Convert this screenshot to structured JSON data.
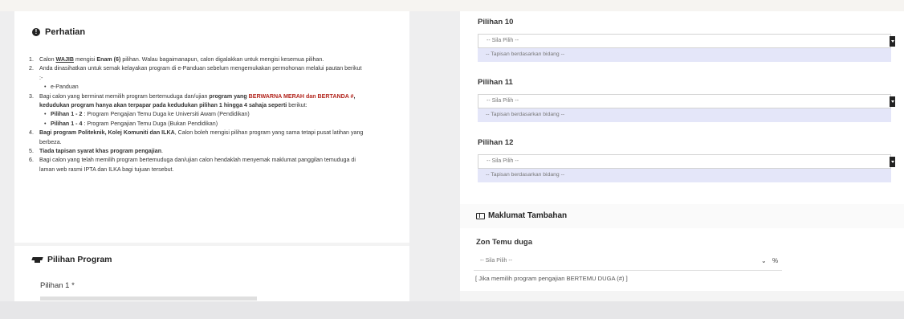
{
  "left": {
    "perhatian_title": "Perhatian",
    "notes": [
      {
        "num": "1.",
        "parts": [
          {
            "t": "Calon ",
            "s": ""
          },
          {
            "t": "WAJIB",
            "s": "u"
          },
          {
            "t": " mengisi ",
            "s": ""
          },
          {
            "t": "Enam (6)",
            "s": "b"
          },
          {
            "t": " pilihan. Walau bagaimanapun, calon digalakkan untuk mengisi kesemua pilihan.",
            "s": ""
          }
        ],
        "subs": []
      },
      {
        "num": "2.",
        "parts": [
          {
            "t": "Anda dinasihatkan untuk semak kelayakan program di e-Panduan sebelum mengemukakan permohonan melalui pautan berikut :-",
            "s": ""
          }
        ],
        "subs": [
          [
            {
              "t": "e-Panduan",
              "s": ""
            }
          ]
        ]
      },
      {
        "num": "3.",
        "parts": [
          {
            "t": "Bagi calon yang berminat memilih program bertemuduga dan/ujian ",
            "s": ""
          },
          {
            "t": "program yang ",
            "s": "b"
          },
          {
            "t": "BERWARNA MERAH dan BERTANDA #",
            "s": "red"
          },
          {
            "t": ", kedudukan program hanya akan terpapar pada kedudukan pilihan 1 hingga 4 sahaja seperti",
            "s": "b"
          },
          {
            "t": " berikut:",
            "s": ""
          }
        ],
        "subs": [
          [
            {
              "t": "Pilihan 1 - 2",
              "s": "b"
            },
            {
              "t": " : Program Pengajian Temu Duga ke Universiti Awam (Pendidikan)",
              "s": ""
            }
          ],
          [
            {
              "t": "Pilihan 1 - 4",
              "s": "b"
            },
            {
              "t": " : Program Pengajian Temu Duga (Bukan Pendidikan)",
              "s": ""
            }
          ]
        ]
      },
      {
        "num": "4.",
        "parts": [
          {
            "t": "Bagi program Politeknik, Kolej Komuniti dan ILKA",
            "s": "b"
          },
          {
            "t": ", Calon boleh mengisi pilihan program yang sama tetapi pusat latihan yang berbeza.",
            "s": ""
          }
        ],
        "subs": []
      },
      {
        "num": "5.",
        "parts": [
          {
            "t": "Tiada tapisan syarat khas program pengajian",
            "s": "b"
          },
          {
            "t": ".",
            "s": ""
          }
        ],
        "subs": []
      },
      {
        "num": "6.",
        "parts": [
          {
            "t": "Bagi calon yang telah memilih program bertemuduga dan/ujian calon hendaklah menyemak maklumat panggilan temuduga di laman web rasmi IPTA dan ILKA bagi tujuan tersebut.",
            "s": ""
          }
        ],
        "subs": []
      }
    ],
    "program_title": "Pilihan Program",
    "pilihan1_label": "Pilihan 1 *"
  },
  "right": {
    "choices": [
      {
        "label": "Pilihan 10",
        "select": "-- Sila Pilih --",
        "filter": "-- Tapisan berdasarkan bidang --"
      },
      {
        "label": "Pilihan 11",
        "select": "-- Sila Pilih --",
        "filter": "-- Tapisan berdasarkan bidang --"
      },
      {
        "label": "Pilihan 12",
        "select": "-- Sila Pilih --",
        "filter": "-- Tapisan berdasarkan bidang --"
      }
    ],
    "tambahan_title": "Maklumat Tambahan",
    "zon_label": "Zon Temu duga",
    "zon_select": "-- Sila Pilih --",
    "zon_note": "[ Jika memilih program pengajian BERTEMU DUGA (#) ]"
  },
  "icons": {
    "perhatian": "info-circle-icon",
    "program": "graduation-cap-icon",
    "tambahan": "book-icon",
    "dropdown": "caret-down-icon",
    "link": "link-icon"
  },
  "colors": {
    "warning_red": "#b3261e",
    "filter_bg": "#e4e6f9"
  }
}
